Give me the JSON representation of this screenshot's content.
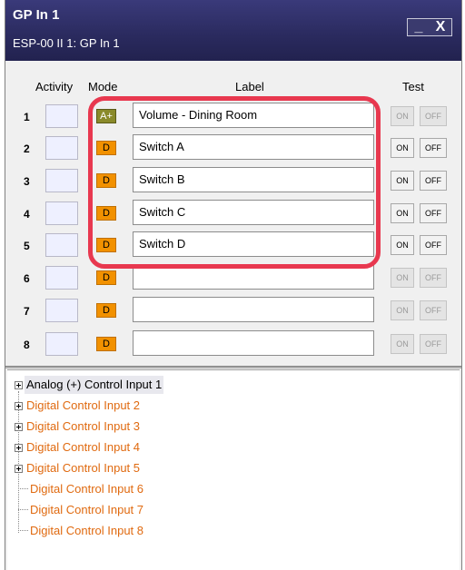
{
  "window": {
    "title": "GP In 1",
    "subtitle": "ESP-00 II 1: GP In 1",
    "minimize": "_",
    "close": "X"
  },
  "columns": {
    "activity": "Activity",
    "mode": "Mode",
    "label": "Label",
    "test": "Test"
  },
  "rows": [
    {
      "num": "1",
      "mode": "A+",
      "label": "Volume - Dining Room",
      "on": "ON",
      "off": "OFF"
    },
    {
      "num": "2",
      "mode": "D",
      "label": "Switch A",
      "on": "ON",
      "off": "OFF"
    },
    {
      "num": "3",
      "mode": "D",
      "label": "Switch B",
      "on": "ON",
      "off": "OFF"
    },
    {
      "num": "4",
      "mode": "D",
      "label": "Switch C",
      "on": "ON",
      "off": "OFF"
    },
    {
      "num": "5",
      "mode": "D",
      "label": "Switch D",
      "on": "ON",
      "off": "OFF"
    },
    {
      "num": "6",
      "mode": "D",
      "label": "",
      "on": "ON",
      "off": "OFF"
    },
    {
      "num": "7",
      "mode": "D",
      "label": "",
      "on": "ON",
      "off": "OFF"
    },
    {
      "num": "8",
      "mode": "D",
      "label": "",
      "on": "ON",
      "off": "OFF"
    }
  ],
  "tree": [
    {
      "label": "Analog (+) Control Input 1",
      "expandable": true
    },
    {
      "label": "Digital Control Input 2",
      "expandable": true
    },
    {
      "label": "Digital Control Input 3",
      "expandable": true
    },
    {
      "label": "Digital Control Input 4",
      "expandable": true
    },
    {
      "label": "Digital Control Input 5",
      "expandable": true
    },
    {
      "label": "Digital Control Input 6",
      "expandable": false
    },
    {
      "label": "Digital Control Input 7",
      "expandable": false
    },
    {
      "label": "Digital Control Input 8",
      "expandable": false
    }
  ],
  "colors": {
    "titlebar": "#2a2a5e",
    "mode_digital": "#f29100",
    "mode_analog": "#8a8a2a",
    "highlight": "#e8384f",
    "tree_text": "#e06a10"
  }
}
